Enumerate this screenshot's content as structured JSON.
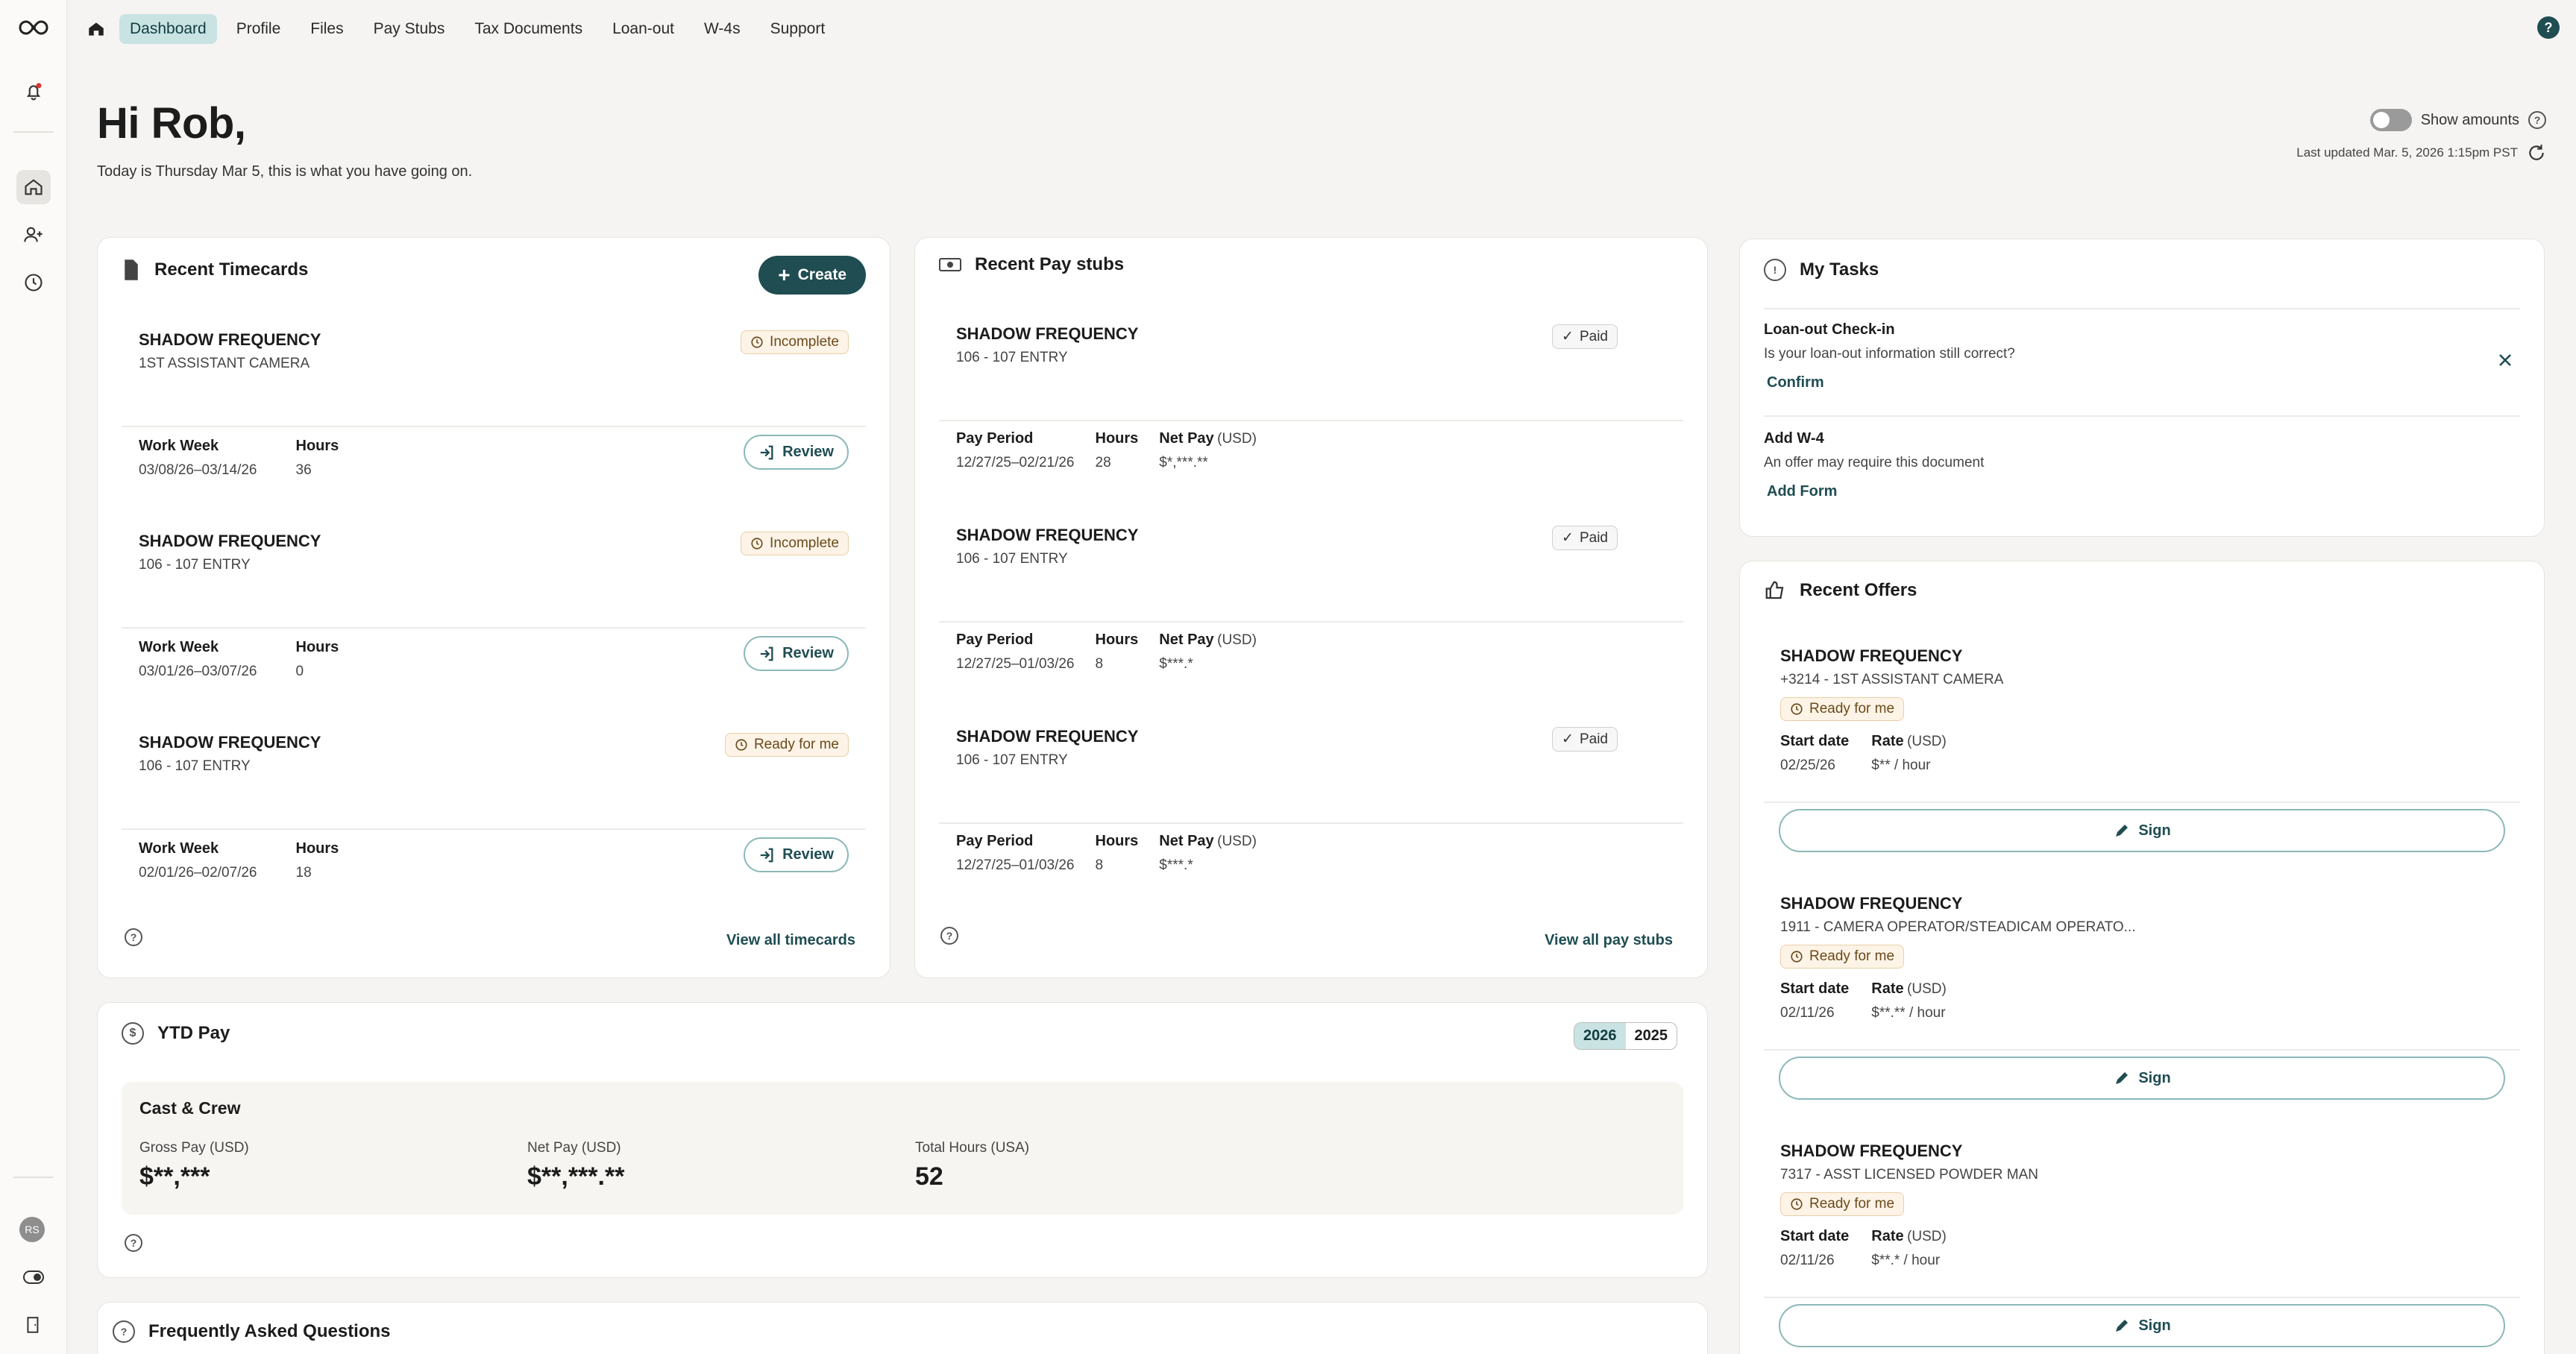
{
  "nav": {
    "items": [
      "Dashboard",
      "Profile",
      "Files",
      "Pay Stubs",
      "Tax Documents",
      "Loan-out",
      "W-4s",
      "Support"
    ],
    "active_index": 0,
    "help": "?"
  },
  "rail": {
    "avatar_initials": "RS"
  },
  "greeting": {
    "title": "Hi Rob,",
    "subtitle": "Today is Thursday Mar 5, this is what you have going on.",
    "show_amounts": "Show amounts",
    "show_amounts_on": false,
    "last_updated": "Last updated Mar. 5, 2026 1:15pm PST"
  },
  "timecards": {
    "title": "Recent Timecards",
    "create": "Create",
    "entries": [
      {
        "project": "SHADOW FREQUENCY",
        "role": "1ST ASSISTANT CAMERA",
        "status": "Incomplete",
        "week_label": "Work Week",
        "hours_label": "Hours",
        "week": "03/08/26–03/14/26",
        "hours": "36",
        "review": "Review"
      },
      {
        "project": "SHADOW FREQUENCY",
        "role": "106 - 107 ENTRY",
        "status": "Incomplete",
        "week_label": "Work Week",
        "hours_label": "Hours",
        "week": "03/01/26–03/07/26",
        "hours": "0",
        "review": "Review"
      },
      {
        "project": "SHADOW FREQUENCY",
        "role": "106 - 107 ENTRY",
        "status": "Ready for me",
        "week_label": "Work Week",
        "hours_label": "Hours",
        "week": "02/01/26–02/07/26",
        "hours": "18",
        "review": "Review"
      }
    ],
    "view_all": "View all timecards"
  },
  "paystubs": {
    "title": "Recent Pay stubs",
    "entries": [
      {
        "project": "SHADOW FREQUENCY",
        "role": "106 - 107 ENTRY",
        "status": "Paid",
        "period_label": "Pay Period",
        "hours_label": "Hours",
        "net_label": "Net Pay",
        "net_unit": "(USD)",
        "period": "12/27/25–02/21/26",
        "hours": "28",
        "net": "$*,***.**"
      },
      {
        "project": "SHADOW FREQUENCY",
        "role": "106 - 107 ENTRY",
        "status": "Paid",
        "period_label": "Pay Period",
        "hours_label": "Hours",
        "net_label": "Net Pay",
        "net_unit": "(USD)",
        "period": "12/27/25–01/03/26",
        "hours": "8",
        "net": "$***.*"
      },
      {
        "project": "SHADOW FREQUENCY",
        "role": "106 - 107 ENTRY",
        "status": "Paid",
        "period_label": "Pay Period",
        "hours_label": "Hours",
        "net_label": "Net Pay",
        "net_unit": "(USD)",
        "period": "12/27/25–01/03/26",
        "hours": "8",
        "net": "$***.*"
      }
    ],
    "view_all": "View all pay stubs"
  },
  "tasks": {
    "title": "My Tasks",
    "items": [
      {
        "title": "Loan-out Check-in",
        "desc": "Is your loan-out information still correct?",
        "action": "Confirm"
      },
      {
        "title": "Add W-4",
        "desc": "An offer may require this document",
        "action": "Add Form"
      }
    ]
  },
  "offers": {
    "title": "Recent Offers",
    "items": [
      {
        "project": "SHADOW FREQUENCY",
        "role": "+3214 - 1ST ASSISTANT CAMERA",
        "status": "Ready for me",
        "start_label": "Start date",
        "rate_label": "Rate",
        "rate_unit": "(USD)",
        "start": "02/25/26",
        "rate": "$** / hour",
        "sign": "Sign"
      },
      {
        "project": "SHADOW FREQUENCY",
        "role": "1911 - CAMERA OPERATOR/STEADICAM OPERATO...",
        "status": "Ready for me",
        "start_label": "Start date",
        "rate_label": "Rate",
        "rate_unit": "(USD)",
        "start": "02/11/26",
        "rate": "$**.** / hour",
        "sign": "Sign"
      },
      {
        "project": "SHADOW FREQUENCY",
        "role": "7317 - ASST LICENSED POWDER MAN",
        "status": "Ready for me",
        "start_label": "Start date",
        "rate_label": "Rate",
        "rate_unit": "(USD)",
        "start": "02/11/26",
        "rate": "$**.* / hour",
        "sign": "Sign"
      }
    ]
  },
  "ytd": {
    "title": "YTD Pay",
    "years": [
      "2026",
      "2025"
    ],
    "employer": "Cast & Crew",
    "gross_label": "Gross Pay (USD)",
    "gross": "$**,***",
    "net_label": "Net Pay (USD)",
    "net": "$**,***.**",
    "hours_label": "Total Hours (USA)",
    "hours": "52"
  },
  "faq": {
    "title": "Frequently Asked Questions"
  }
}
